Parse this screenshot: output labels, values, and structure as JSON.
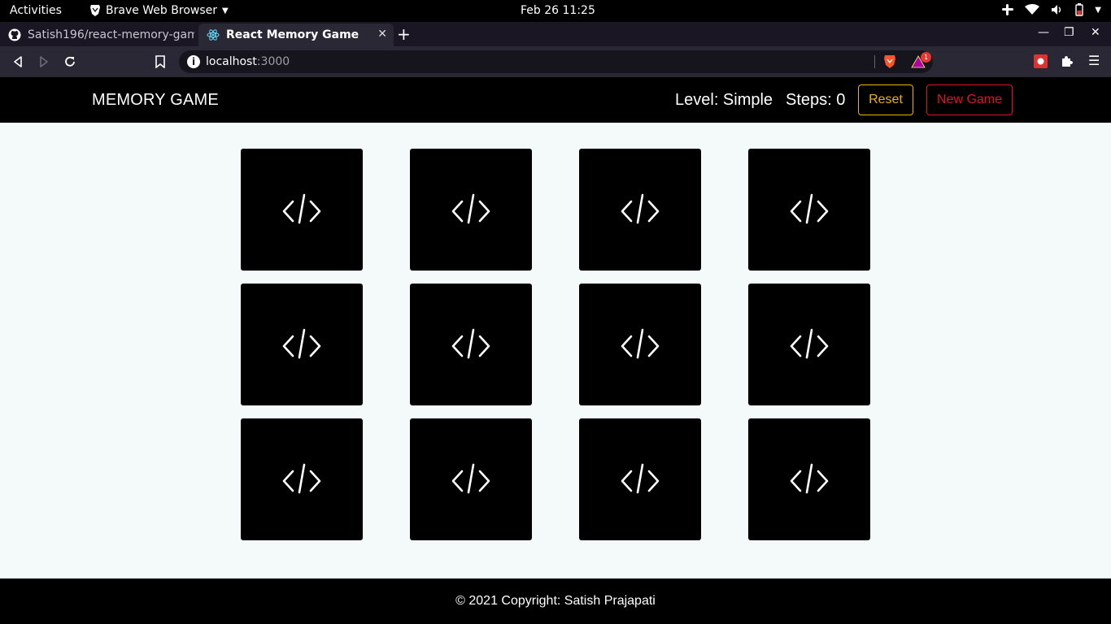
{
  "system_bar": {
    "activities": "Activities",
    "app_name": "Brave Web Browser",
    "clock": "Feb 26  11:25"
  },
  "browser": {
    "tabs": [
      {
        "label": "Satish196/react-memory-gam",
        "icon": "github-icon",
        "active": false
      },
      {
        "label": "React Memory Game",
        "icon": "react-icon",
        "active": true
      }
    ],
    "url_host": "localhost",
    "url_port": ":3000",
    "rewards_badge": "1"
  },
  "app": {
    "brand": "MEMORY GAME",
    "level_text": "Level: Simple",
    "steps_text": "Steps: 0",
    "reset_label": "Reset",
    "new_game_label": "New Game",
    "accent_reset": "#f0b400",
    "accent_new_game": "#e0102c",
    "card_back_icon": "code-icon",
    "card_count": 12,
    "footer": "© 2021 Copyright: Satish Prajapati"
  }
}
